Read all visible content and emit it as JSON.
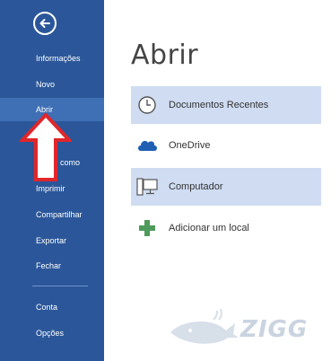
{
  "sidebar": {
    "back_icon": "arrow-left-circle-icon",
    "items": [
      {
        "id": "informacoes",
        "label": "Informações"
      },
      {
        "id": "novo",
        "label": "Novo"
      },
      {
        "id": "abrir",
        "label": "Abrir",
        "active": true
      },
      {
        "id": "salvar-como",
        "label": "como"
      },
      {
        "id": "imprimir",
        "label": "Imprimir"
      },
      {
        "id": "compartilhar",
        "label": "Compartilhar"
      },
      {
        "id": "exportar",
        "label": "Exportar"
      },
      {
        "id": "fechar",
        "label": "Fechar"
      },
      {
        "id": "conta",
        "label": "Conta"
      },
      {
        "id": "opcoes",
        "label": "Opções"
      }
    ]
  },
  "main": {
    "title": "Abrir",
    "places": [
      {
        "label": "Documentos Recentes",
        "icon": "clock-icon",
        "selected": true
      },
      {
        "label": "OneDrive",
        "icon": "cloud-icon",
        "selected": false
      },
      {
        "label": "Computador",
        "icon": "computer-icon",
        "selected": true
      },
      {
        "label": "Adicionar um local",
        "icon": "plus-icon",
        "selected": false
      }
    ]
  },
  "watermark": {
    "text": "ZIGG"
  },
  "colors": {
    "sidebar_bg": "#2b579a",
    "sidebar_active": "#3f6fb5",
    "selected_bg": "#cfdcf2",
    "arrow_red": "#e0262b",
    "plus_green": "#4e9a5b",
    "onedrive_blue": "#1e5fb3"
  }
}
